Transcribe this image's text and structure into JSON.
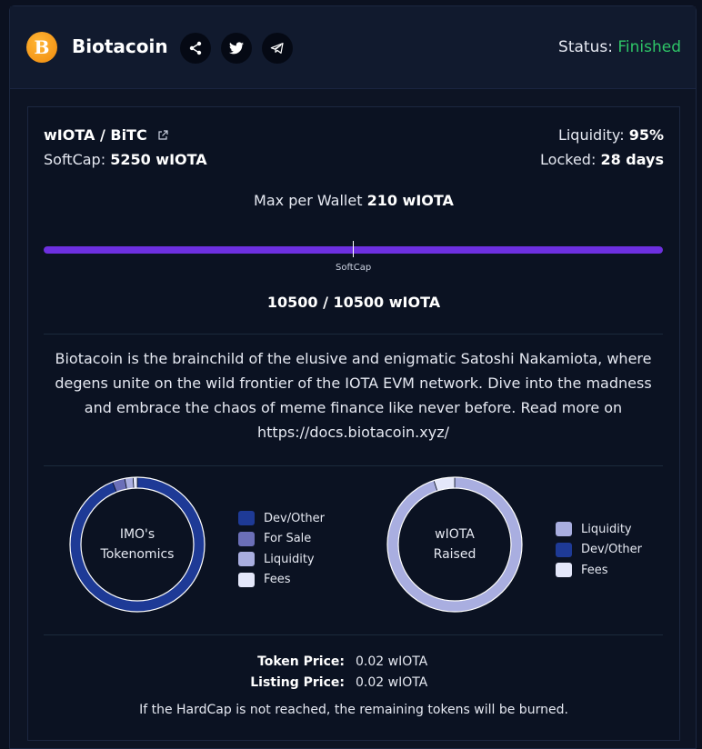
{
  "header": {
    "logo_letter": "B",
    "title": "Biotacoin",
    "social_icons": [
      "share-icon",
      "twitter-icon",
      "telegram-icon"
    ],
    "status_label": "Status:",
    "status_value": "Finished",
    "status_color": "#2ec567"
  },
  "sale": {
    "pair": "wIOTA / BiTC",
    "softcap_label": "SoftCap:",
    "softcap_value": "5250 wIOTA",
    "liquidity_label": "Liquidity:",
    "liquidity_value": "95%",
    "locked_label": "Locked:",
    "locked_value": "28 days",
    "max_wallet_label": "Max per Wallet",
    "max_wallet_value": "210 wIOTA",
    "progress_fraction": 1.0,
    "softcap_marker_label": "SoftCap",
    "raised_text": "10500 / 10500 wIOTA",
    "progress_color": "#6d2fe0"
  },
  "description": "Biotacoin is the brainchild of the elusive and enigmatic Satoshi Nakamiota, where degens unite on the wild frontier of the IOTA EVM network. Dive into the madness and embrace the chaos of meme finance like never before. Read more on https://docs.biotacoin.xyz/",
  "tokenomics": {
    "label_line1": "IMO's",
    "label_line2": "Tokenomics",
    "legend": [
      {
        "label": "Dev/Other",
        "color": "#1e3a96"
      },
      {
        "label": "For Sale",
        "color": "#6b6fb8"
      },
      {
        "label": "Liquidity",
        "color": "#a9aee0"
      },
      {
        "label": "Fees",
        "color": "#e4e7fa"
      }
    ],
    "slices": [
      {
        "label": "Dev/Other",
        "value": 94
      },
      {
        "label": "For Sale",
        "value": 3
      },
      {
        "label": "Liquidity",
        "value": 2
      },
      {
        "label": "Fees",
        "value": 1
      }
    ]
  },
  "raised": {
    "label_line1": "wIOTA",
    "label_line2": "Raised",
    "legend": [
      {
        "label": "Liquidity",
        "color": "#a9aee0"
      },
      {
        "label": "Dev/Other",
        "color": "#1e3a96"
      },
      {
        "label": "Fees",
        "color": "#e4e7fa"
      }
    ],
    "slices": [
      {
        "label": "Liquidity",
        "value": 95
      },
      {
        "label": "Dev/Other",
        "value": 0
      },
      {
        "label": "Fees",
        "value": 5
      }
    ]
  },
  "prices": {
    "token_price_label": "Token Price:",
    "token_price_value": "0.02 wIOTA",
    "listing_price_label": "Listing Price:",
    "listing_price_value": "0.02 wIOTA"
  },
  "note": "If the HardCap is not reached, the remaining tokens will be burned."
}
